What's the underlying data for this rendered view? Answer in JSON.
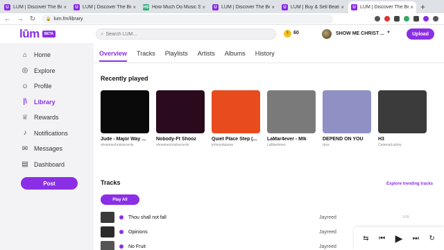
{
  "browser": {
    "tabs": [
      {
        "favicon": "U",
        "title": "LŪM | Discover The Be",
        "active": false
      },
      {
        "favicon": "U",
        "title": "LŪM | Discover The Be",
        "active": false
      },
      {
        "favicon": "HS",
        "title": "How Much Do Music St",
        "active": false
      },
      {
        "favicon": "U",
        "title": "LŪM | Discover The Be",
        "active": false
      },
      {
        "favicon": "U",
        "title": "LŪM | Buy & Sell Beats",
        "active": false
      },
      {
        "favicon": "U",
        "title": "LŪM | Discover The Be",
        "active": true
      }
    ],
    "new_tab": "+",
    "url": "lum.fm/library"
  },
  "header": {
    "logo": "lūm",
    "beta": "BETA",
    "search_placeholder": "Search LŪM...",
    "coins": "60",
    "username": "SHOW ME CHRIST ...",
    "upload": "Upload"
  },
  "sidebar": {
    "items": [
      {
        "label": "Home",
        "icon": "home-icon",
        "glyph": "⌂"
      },
      {
        "label": "Explore",
        "icon": "compass-icon",
        "glyph": "◎"
      },
      {
        "label": "Profile",
        "icon": "profile-icon",
        "glyph": "☺"
      },
      {
        "label": "Library",
        "icon": "library-icon",
        "glyph": "|\\",
        "active": true
      },
      {
        "label": "Rewards",
        "icon": "rewards-icon",
        "glyph": "♕"
      },
      {
        "label": "Notifications",
        "icon": "bell-icon",
        "glyph": "♪"
      },
      {
        "label": "Messages",
        "icon": "messages-icon",
        "glyph": "✉"
      },
      {
        "label": "Dashboard",
        "icon": "dashboard-icon",
        "glyph": "▤"
      }
    ],
    "post": "Post"
  },
  "main": {
    "tabs": [
      "Overview",
      "Tracks",
      "Playlists",
      "Artists",
      "Albums",
      "History"
    ],
    "recently_played_title": "Recently played",
    "recent": [
      {
        "title": "Jude - Major Way ...",
        "artist": "showmechristrecords",
        "bg": "#0a0a0a"
      },
      {
        "title": "Nobody-Ft Shooz",
        "artist": "showmechristrecords",
        "bg": "#2a0b1e"
      },
      {
        "title": "Quiet Place Step (...",
        "artist": "johnnydukane",
        "bg": "#e84b1c"
      },
      {
        "title": "LaMar4ever - Mlk",
        "artist": "LaMar4ever",
        "bg": "#7a7a7a"
      },
      {
        "title": "DEPEND ON YOU",
        "artist": "rjrox",
        "bg": "#8f90c4"
      },
      {
        "title": "H3",
        "artist": "CedenioLuttery",
        "bg": "#3b3b3b"
      }
    ],
    "tracks_title": "Tracks",
    "explore_trending": "Explore trending tracks",
    "play_all": "Play All",
    "tracks": [
      {
        "name": "Thou shall not fall",
        "artist": "Jayreed",
        "time": "3:05",
        "thumb": "#3a3a3a"
      },
      {
        "name": "Opinions",
        "artist": "Jayreed",
        "time": "3:04",
        "thumb": "#2b2b2b"
      },
      {
        "name": "No Fruit",
        "artist": "Jayreed",
        "time": "",
        "thumb": "#555555"
      }
    ]
  },
  "player": {
    "shuffle": "⇆",
    "prev": "⏮",
    "play": "▶",
    "next": "⏭",
    "repeat": "↻"
  },
  "colors": {
    "accent": "#8b2fe6"
  }
}
